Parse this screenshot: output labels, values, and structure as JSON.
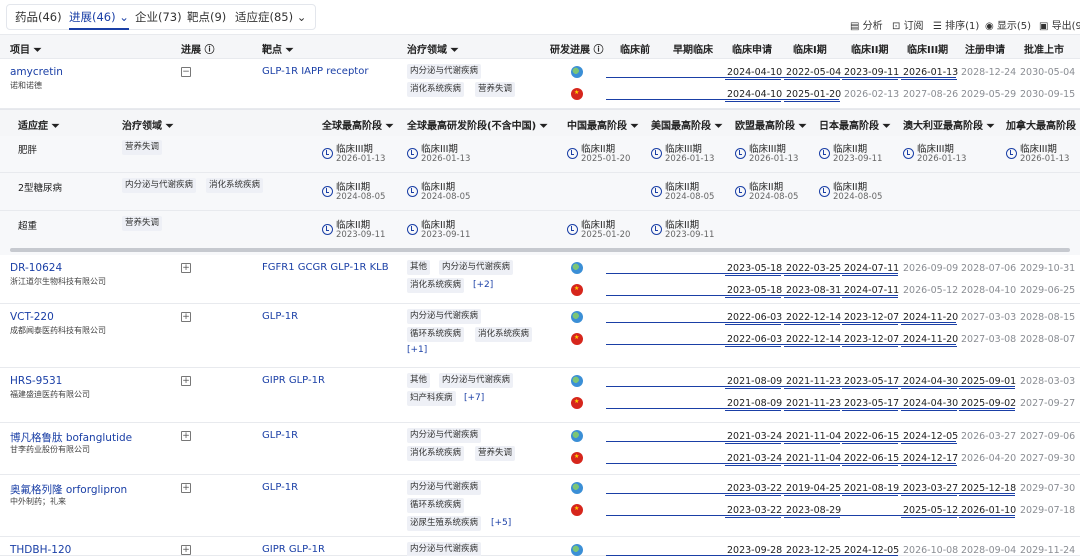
{
  "tabs": [
    {
      "label": "药品(46)",
      "active": false
    },
    {
      "label": "进展(46) ⌄",
      "active": true
    },
    {
      "label": "企业(73)",
      "active": false
    },
    {
      "label": "靶点(9)",
      "active": false
    },
    {
      "label": "适应症(85) ⌄",
      "active": false
    }
  ],
  "toolbar": {
    "analysis": "分析",
    "subscribe": "订阅",
    "sort": "排序(1)",
    "display": "显示(5)",
    "export": "导出(9"
  },
  "headers": {
    "project": "项目",
    "progress": "进展",
    "target": "靶点",
    "area": "治疗领域",
    "rd": "研发进展",
    "phases": [
      "临床前",
      "早期临床",
      "临床申请",
      "临床I期",
      "临床II期",
      "临床III期",
      "注册申请",
      "批准上市"
    ]
  },
  "panel": {
    "headers": {
      "indication": "适应症",
      "area": "治疗领域",
      "global": "全球最高阶段",
      "global_ex_cn": "全球最高研发阶段(不含中国)",
      "china": "中国最高阶段",
      "us": "美国最高阶段",
      "eu": "欧盟最高阶段",
      "jp": "日本最高阶段",
      "au": "澳大利亚最高阶段",
      "ca": "加拿大最高阶段"
    },
    "rows": [
      {
        "indication": "肥胖",
        "areas": [
          "营养失调"
        ],
        "stages": [
          [
            "临床III期",
            "2026-01-13"
          ],
          [
            "临床III期",
            "2026-01-13"
          ],
          [
            "临床II期",
            "2025-01-20"
          ],
          [
            "临床III期",
            "2026-01-13"
          ],
          [
            "临床III期",
            "2026-01-13"
          ],
          [
            "临床II期",
            "2023-09-11"
          ],
          [
            "临床III期",
            "2026-01-13"
          ],
          [
            "临床III期",
            "2026-01-13"
          ]
        ]
      },
      {
        "indication": "2型糖尿病",
        "areas": [
          "内分泌与代谢疾病",
          "消化系统疾病"
        ],
        "stages": [
          [
            "临床II期",
            "2024-08-05"
          ],
          [
            "临床II期",
            "2024-08-05"
          ],
          null,
          [
            "临床II期",
            "2024-08-05"
          ],
          [
            "临床II期",
            "2024-08-05"
          ],
          [
            "临床II期",
            "2024-08-05"
          ],
          null,
          null
        ]
      },
      {
        "indication": "超重",
        "areas": [
          "营养失调"
        ],
        "stages": [
          [
            "临床II期",
            "2023-09-11"
          ],
          [
            "临床II期",
            "2023-09-11"
          ],
          [
            "临床II期",
            "2025-01-20"
          ],
          [
            "临床II期",
            "2023-09-11"
          ],
          null,
          null,
          null,
          null
        ]
      }
    ]
  },
  "projects": [
    {
      "name": "amycretin",
      "org": "诺和诺德",
      "expanded": true,
      "expand_sign": "−",
      "target": "GLP-1R IAPP receptor",
      "area_lines": [
        [
          "内分泌与代谢疾病"
        ],
        [
          "消化系统疾病",
          "营养失调"
        ]
      ],
      "more": "",
      "dates": [
        [
          "2024-04-10",
          "2022-05-04",
          "2023-09-11",
          "2026-01-13",
          "2028-12-24",
          "2030-05-04"
        ],
        [
          "2024-04-10",
          "2025-01-20",
          "2026-02-13",
          "2027-08-26",
          "2029-05-29",
          "2030-09-15"
        ]
      ],
      "actual": [
        4,
        2
      ]
    },
    {
      "name": "DR-10624",
      "org": "浙江道尔生物科技有限公司",
      "expanded": false,
      "expand_sign": "+",
      "target": "FGFR1 GCGR GLP-1R KLB",
      "area_lines": [
        [
          "其他",
          "内分泌与代谢疾病"
        ],
        [
          "消化系统疾病"
        ]
      ],
      "more": "[+2]",
      "dates": [
        [
          "2023-05-18",
          "2022-03-25",
          "2024-07-11",
          "2026-09-09",
          "2028-07-06",
          "2029-10-31"
        ],
        [
          "2023-05-18",
          "2023-08-31",
          "2024-07-11",
          "2026-05-12",
          "2028-04-10",
          "2029-06-25"
        ]
      ],
      "actual": [
        3,
        3
      ]
    },
    {
      "name": "VCT-220",
      "org": "成都闻泰医药科技有限公司",
      "expanded": false,
      "expand_sign": "+",
      "target": "GLP-1R",
      "area_lines": [
        [
          "内分泌与代谢疾病"
        ],
        [
          "循环系统疾病",
          "消化系统疾病"
        ]
      ],
      "more": "[+1]",
      "dates": [
        [
          "2022-06-03",
          "2022-12-14",
          "2023-12-07",
          "2024-11-20",
          "2027-03-03",
          "2028-08-15"
        ],
        [
          "2022-06-03",
          "2022-12-14",
          "2023-12-07",
          "2024-11-20",
          "2027-03-08",
          "2028-08-07"
        ]
      ],
      "actual": [
        4,
        4
      ]
    },
    {
      "name": "HRS-9531",
      "org": "福建盛迪医药有限公司",
      "expanded": false,
      "expand_sign": "+",
      "target": "GIPR GLP-1R",
      "area_lines": [
        [
          "其他",
          "内分泌与代谢疾病"
        ],
        [
          "妇产科疾病"
        ]
      ],
      "more": "[+7]",
      "dates": [
        [
          "2021-08-09",
          "2021-11-23",
          "2023-05-17",
          "2024-04-30",
          "2025-09-01",
          "2028-03-03"
        ],
        [
          "2021-08-09",
          "2021-11-23",
          "2023-05-17",
          "2024-04-30",
          "2025-09-02",
          "2027-09-27"
        ]
      ],
      "actual": [
        5,
        5
      ]
    },
    {
      "name": "博凡格鲁肽 bofanglutide",
      "org": "甘李药业股份有限公司",
      "expanded": false,
      "expand_sign": "+",
      "target": "GLP-1R",
      "area_lines": [
        [
          "内分泌与代谢疾病"
        ],
        [
          "消化系统疾病",
          "营养失调"
        ]
      ],
      "more": "",
      "dates": [
        [
          "2021-03-24",
          "2021-11-04",
          "2022-06-15",
          "2024-12-05",
          "2026-03-27",
          "2027-09-06"
        ],
        [
          "2021-03-24",
          "2021-11-04",
          "2022-06-15",
          "2024-12-17",
          "2026-04-20",
          "2027-09-30"
        ]
      ],
      "actual": [
        4,
        4
      ]
    },
    {
      "name": "奥氟格列隆 orforglipron",
      "org": "中外制药；礼来",
      "expanded": false,
      "expand_sign": "+",
      "target": "GLP-1R",
      "area_lines": [
        [
          "内分泌与代谢疾病"
        ],
        [
          "循环系统疾病"
        ],
        [
          "泌尿生殖系统疾病"
        ]
      ],
      "more": "[+5]",
      "dates": [
        [
          "2023-03-22",
          "2019-04-25",
          "2021-08-19",
          "2023-03-27",
          "2025-12-18",
          "2029-07-30"
        ],
        [
          "2023-03-22",
          "2023-08-29",
          "",
          "2025-05-12",
          "2026-01-10",
          "2029-07-18"
        ]
      ],
      "actual": [
        5,
        5
      ]
    },
    {
      "name": "THDBH-120",
      "org": "",
      "expanded": false,
      "expand_sign": "+",
      "target": "GIPR GLP-1R",
      "area_lines": [
        [
          "内分泌与代谢疾病"
        ]
      ],
      "more": "",
      "dates": [
        [
          "2023-09-28",
          "2023-12-25",
          "2024-12-05",
          "2026-10-08",
          "2028-09-04",
          "2029-11-24"
        ]
      ],
      "actual": [
        3
      ]
    }
  ]
}
